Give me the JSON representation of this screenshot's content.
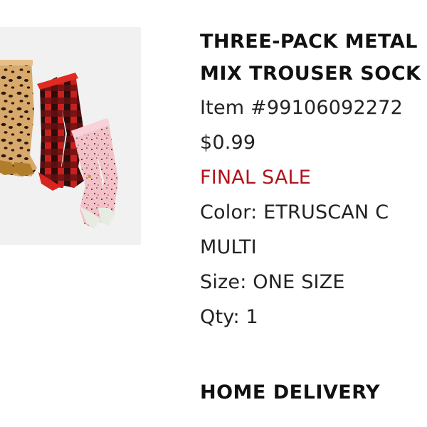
{
  "product": {
    "title_line1": "THREE-PACK METAL",
    "title_line2": "MIX TROUSER SOCK",
    "item": "Item #99106092272",
    "price": "$0.99",
    "sale_label": "FINAL SALE",
    "color": "Color: ETRUSCAN C",
    "color_cont": "MULTI",
    "size": "Size: ONE SIZE",
    "qty": "Qty: 1"
  },
  "section": {
    "delivery_heading": "HOME DELIVERY"
  },
  "colors": {
    "sale": "#b3121b",
    "text": "#222222",
    "image_bg": "#f1f1f1"
  }
}
